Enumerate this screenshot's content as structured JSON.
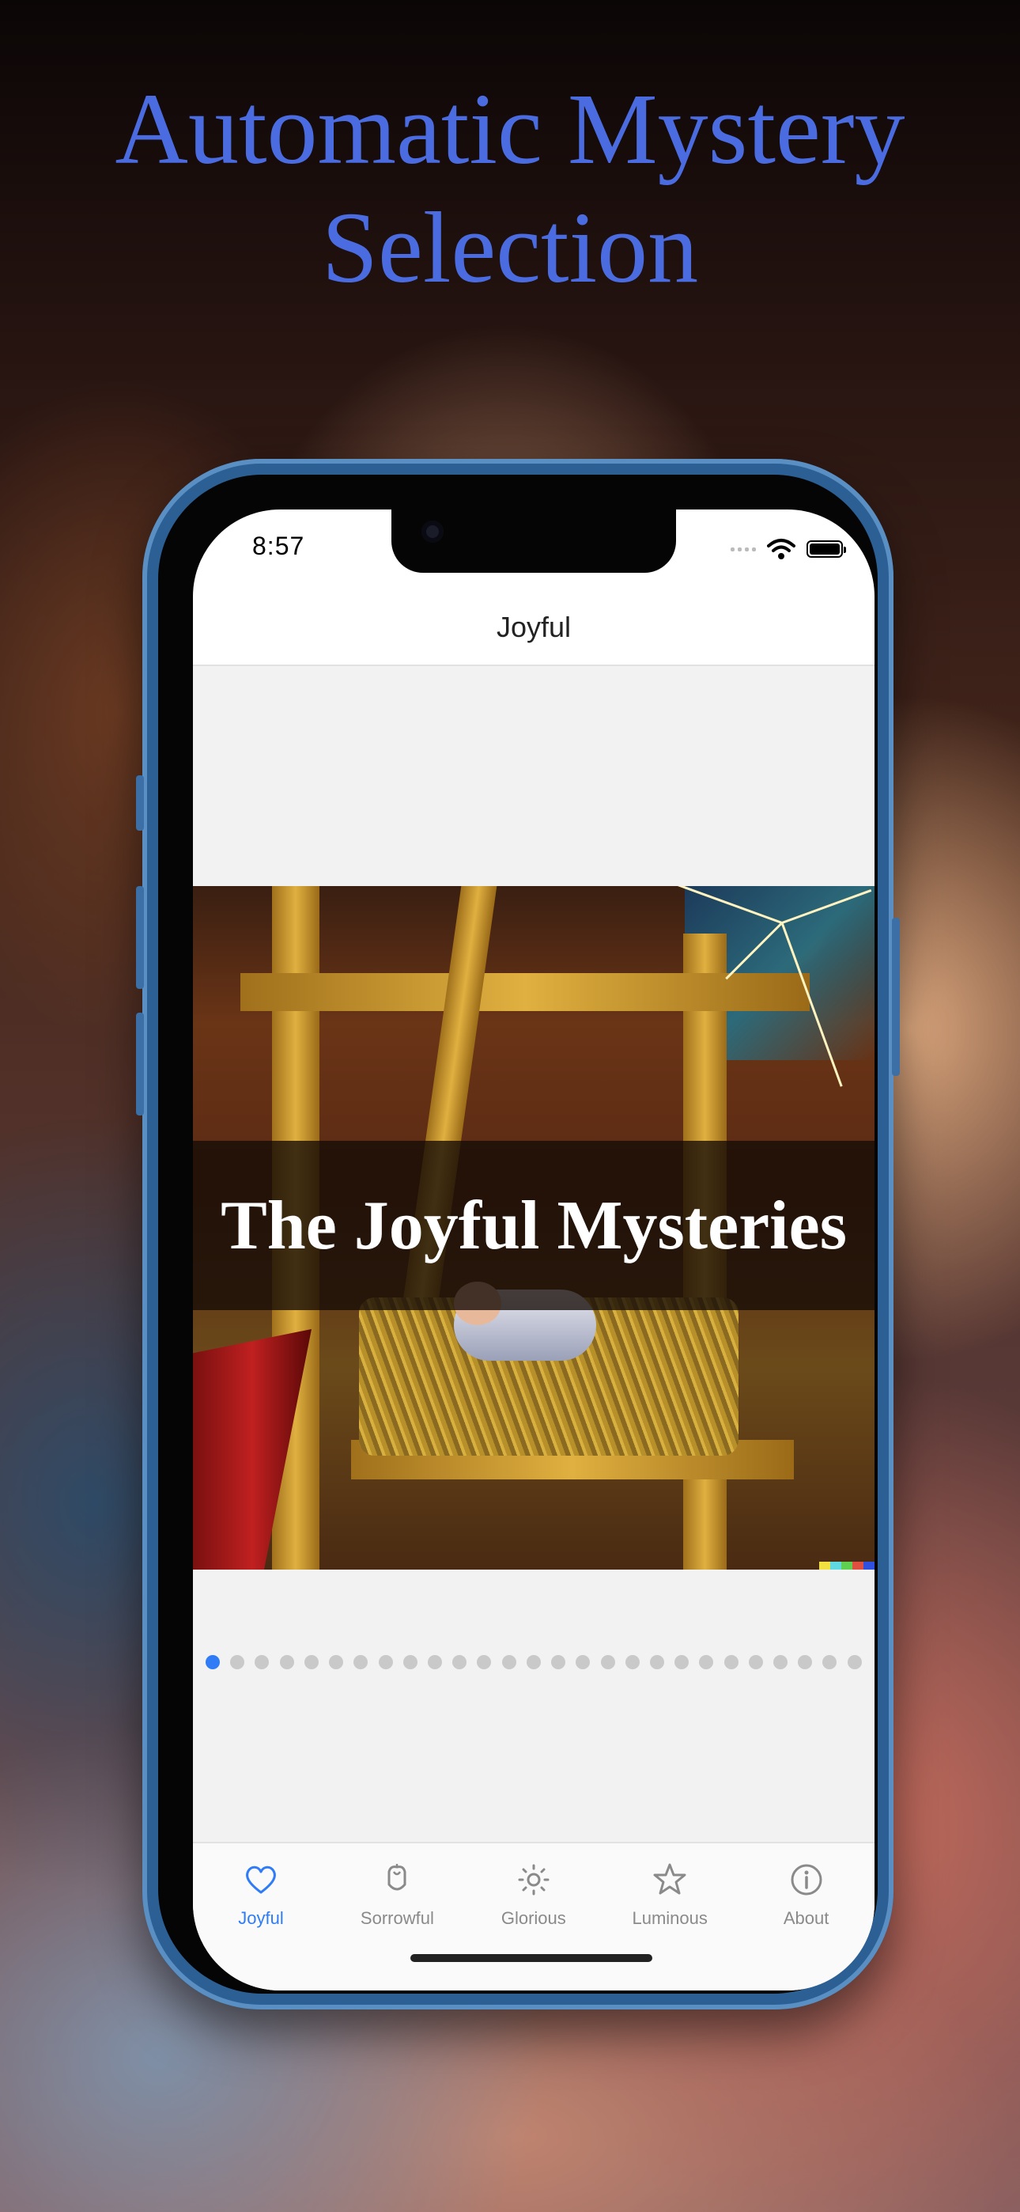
{
  "promo": {
    "title_line1": "Automatic Mystery",
    "title_line2": "Selection"
  },
  "status_bar": {
    "time": "8:57"
  },
  "nav": {
    "title": "Joyful"
  },
  "slide": {
    "banner_text": "The Joyful Mysteries"
  },
  "pager": {
    "total": 27,
    "current": 1
  },
  "tabs": [
    {
      "label": "Joyful",
      "icon": "heart-icon",
      "selected": true
    },
    {
      "label": "Sorrowful",
      "icon": "rose-icon",
      "selected": false
    },
    {
      "label": "Glorious",
      "icon": "sun-icon",
      "selected": false
    },
    {
      "label": "Luminous",
      "icon": "star-icon",
      "selected": false
    },
    {
      "label": "About",
      "icon": "info-icon",
      "selected": false
    }
  ],
  "colors": {
    "accent": "#2f7cf6",
    "promo_title": "#4a6ce0",
    "inactive": "#8a8a8a"
  }
}
